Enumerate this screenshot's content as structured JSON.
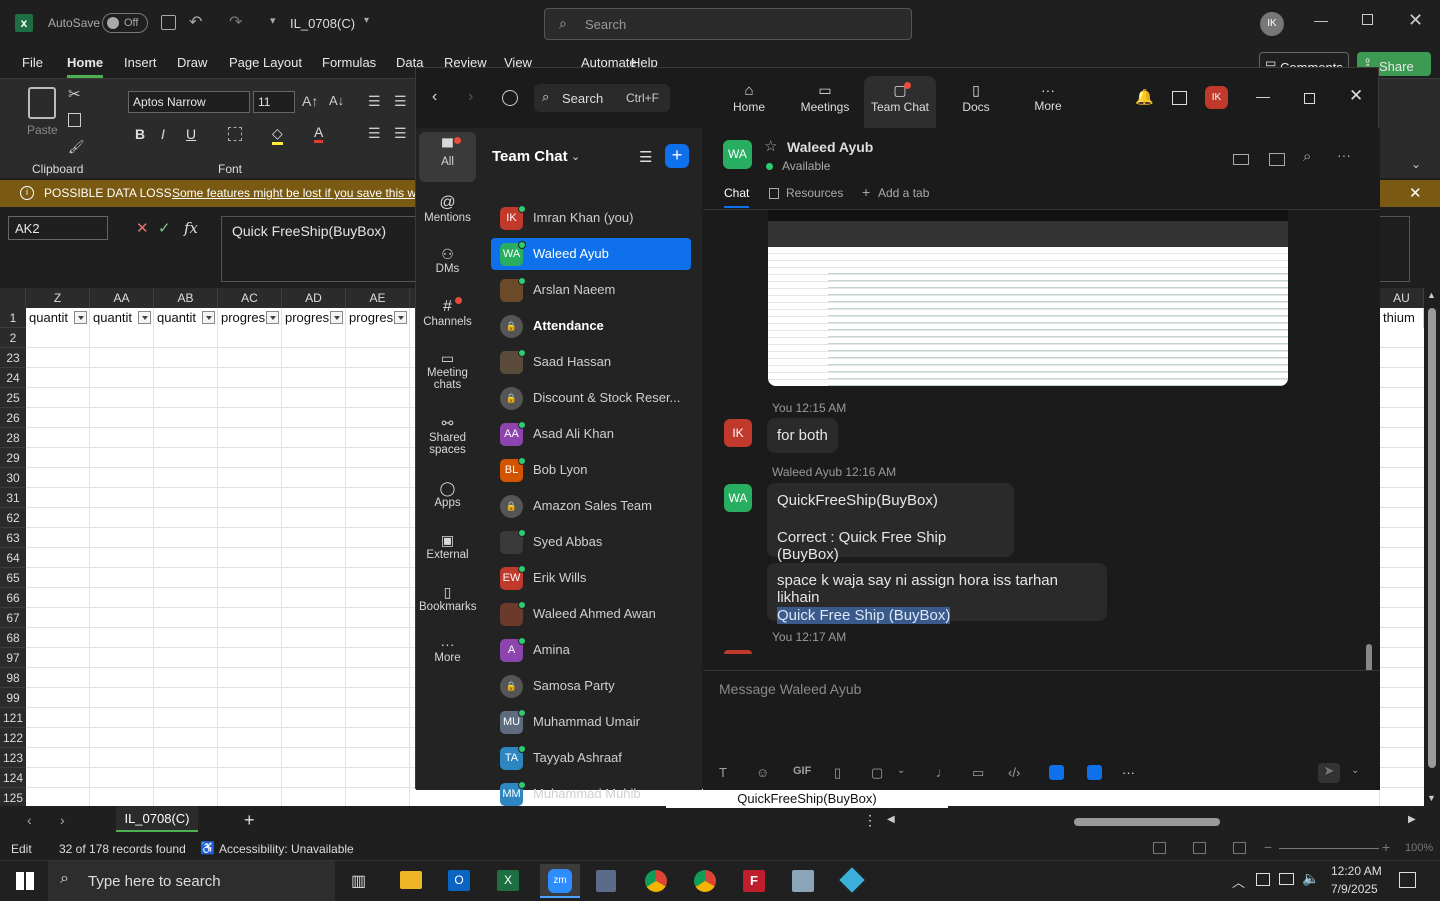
{
  "excel": {
    "autosave_label": "AutoSave",
    "autosave_state": "Off",
    "file_name": "IL_0708(C)",
    "search_placeholder": "Search",
    "user_initials": "IK",
    "menu": [
      "File",
      "Home",
      "Insert",
      "Draw",
      "Page Layout",
      "Formulas",
      "Data",
      "Review",
      "View",
      "Automate",
      "Help"
    ],
    "comments_label": "Comments",
    "share_label": "Share",
    "ribbon": {
      "paste_label": "Paste",
      "clipboard_label": "Clipboard",
      "font_name": "Aptos Narrow",
      "font_size": "11",
      "font_label": "Font",
      "bold": "B",
      "italic": "I",
      "underline": "U"
    },
    "warning": {
      "title": "POSSIBLE DATA LOSS",
      "message": "Some features might be lost if you save this wo"
    },
    "name_box": "AK2",
    "formula": "Quick FreeShip(BuyBox)",
    "fx_label": "fx",
    "columns": [
      "Z",
      "AA",
      "AB",
      "AC",
      "AD",
      "AE"
    ],
    "right_column": "AU",
    "row1_cells": [
      "quantit",
      "quantit",
      "quantit",
      "progres",
      "progres",
      "progres"
    ],
    "right_cell": "thium",
    "rows": [
      "1",
      "2",
      "23",
      "24",
      "25",
      "26",
      "28",
      "29",
      "30",
      "31",
      "62",
      "63",
      "64",
      "65",
      "66",
      "67",
      "68",
      "97",
      "98",
      "99",
      "121",
      "122",
      "123",
      "124",
      "125"
    ],
    "sheet_tab": "IL_0708(C)",
    "add_sheet": "+",
    "cell_tooltip": "QuickFreeShip(BuyBox)",
    "status": {
      "mode": "Edit",
      "records": "32 of 178 records found",
      "accessibility": "Accessibility: Unavailable",
      "zoom": "100%"
    }
  },
  "taskbar": {
    "search_placeholder": "Type here to search",
    "time": "12:20 AM",
    "date": "7/9/2025"
  },
  "zoom": {
    "nav": {
      "search_label": "Search",
      "search_shortcut": "Ctrl+F",
      "tabs": [
        {
          "label": "Home",
          "icon": "home-icon"
        },
        {
          "label": "Meetings",
          "icon": "video-icon"
        },
        {
          "label": "Team Chat",
          "icon": "chat-icon"
        },
        {
          "label": "Docs",
          "icon": "doc-icon"
        },
        {
          "label": "More",
          "icon": "more-icon"
        }
      ],
      "avatar": "IK"
    },
    "rail": [
      {
        "label": "All",
        "icon": "chat-bubble-icon"
      },
      {
        "label": "Mentions",
        "icon": "at-icon"
      },
      {
        "label": "DMs",
        "icon": "people-icon"
      },
      {
        "label": "Channels",
        "icon": "hash-icon"
      },
      {
        "label": "Meeting chats",
        "icon": "calendar-icon"
      },
      {
        "label": "Shared spaces",
        "icon": "share-icon"
      },
      {
        "label": "Apps",
        "icon": "apps-icon"
      },
      {
        "label": "External",
        "icon": "external-icon"
      },
      {
        "label": "Bookmarks",
        "icon": "bookmark-icon"
      },
      {
        "label": "More",
        "icon": "more-icon"
      }
    ],
    "list_title": "Team Chat",
    "contacts": [
      {
        "name": "Imran Khan (you)",
        "initials": "IK",
        "color": "#c0392b"
      },
      {
        "name": "Waleed Ayub",
        "initials": "WA",
        "color": "#27ae60"
      },
      {
        "name": "Arslan Naeem",
        "initials": "",
        "color": "#6b4a2a"
      },
      {
        "name": "Attendance",
        "initials": "",
        "color": "#555555"
      },
      {
        "name": "Saad Hassan",
        "initials": "",
        "color": "#5a4a3a"
      },
      {
        "name": "Discount & Stock Reser...",
        "initials": "",
        "color": "#555555"
      },
      {
        "name": "Asad Ali Khan",
        "initials": "AA",
        "color": "#8e44ad"
      },
      {
        "name": "Bob Lyon",
        "initials": "BL",
        "color": "#d35400"
      },
      {
        "name": "Amazon Sales Team",
        "initials": "",
        "color": "#555555"
      },
      {
        "name": "Syed Abbas",
        "initials": "",
        "color": "#3a3a3a"
      },
      {
        "name": "Erik Wills",
        "initials": "EW",
        "color": "#c0392b"
      },
      {
        "name": "Waleed Ahmed Awan",
        "initials": "",
        "color": "#6b3a2a"
      },
      {
        "name": "Amina",
        "initials": "A",
        "color": "#8e44ad"
      },
      {
        "name": "Samosa Party",
        "initials": "",
        "color": "#555555"
      },
      {
        "name": "Muhammad Umair",
        "initials": "MU",
        "color": "#5d6d7e"
      },
      {
        "name": "Tayyab Ashraaf",
        "initials": "TA",
        "color": "#2e86c1"
      },
      {
        "name": "Muhammad Muhib",
        "initials": "MM",
        "color": "#2e86c1"
      }
    ],
    "chat": {
      "header_name": "Waleed Ayub",
      "header_initials": "WA",
      "header_status": "Available",
      "tabs": [
        "Chat",
        "Resources",
        "Add a tab"
      ],
      "messages": [
        {
          "meta": "You 12:15 AM",
          "initials": "IK",
          "text": "for both"
        },
        {
          "meta": "Waleed Ayub 12:16 AM",
          "initials": "WA",
          "line1": "QuickFreeShip(BuyBox)",
          "line2": "Correct : Quick Free Ship (BuyBox)"
        },
        {
          "line1": "space k waja say ni assign hora iss tarhan likhain",
          "line2": "Quick Free Ship (BuyBox)"
        },
        {
          "meta": "You 12:17 AM"
        }
      ],
      "composer_placeholder": "Message Waleed Ayub",
      "gif_label": "GIF"
    }
  }
}
